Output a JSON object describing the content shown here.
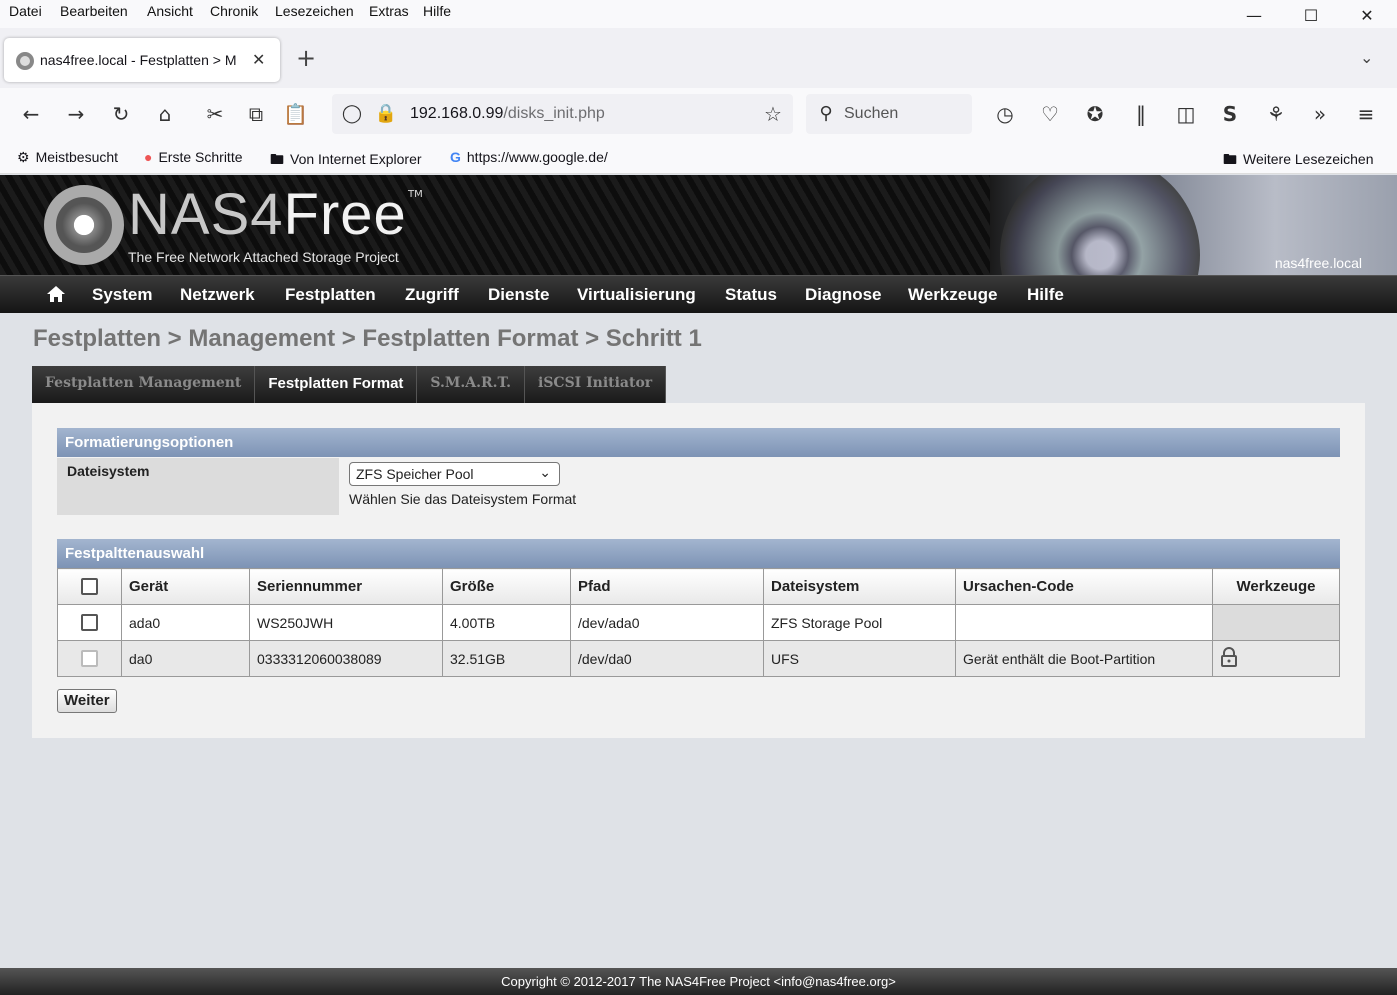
{
  "browser": {
    "menu": [
      "Datei",
      "Bearbeiten",
      "Ansicht",
      "Chronik",
      "Lesezeichen",
      "Extras",
      "Hilfe"
    ],
    "tab_title": "nas4free.local - Festplatten > M",
    "url_host": "192.168.0.99",
    "url_path": "/disks_init.php",
    "search_placeholder": "Suchen",
    "bookmarks": [
      "Meistbesucht",
      "Erste Schritte",
      "Von Internet Explorer",
      "https://www.google.de/"
    ],
    "other_bookmarks": "Weitere Lesezeichen"
  },
  "header": {
    "logo_main": "NAS4",
    "logo_main2": "Free",
    "logo_tm": "TM",
    "logo_subtitle": "The Free Network Attached Storage Project",
    "hostname": "nas4free.local"
  },
  "nav": [
    "System",
    "Netzwerk",
    "Festplatten",
    "Zugriff",
    "Dienste",
    "Virtualisierung",
    "Status",
    "Diagnose",
    "Werkzeuge",
    "Hilfe"
  ],
  "breadcrumb": "Festplatten > Management > Festplatten Format > Schritt 1",
  "tabs": [
    "Festplatten Management",
    "Festplatten Format",
    "S.M.A.R.T.",
    "iSCSI Initiator"
  ],
  "format_options": {
    "section_title": "Formatierungsoptionen",
    "label": "Dateisystem",
    "selected": "ZFS Speicher Pool",
    "hint": "Wählen Sie das Dateisystem Format"
  },
  "disk_selection": {
    "section_title": "Festpalttenauswahl",
    "columns": [
      "Gerät",
      "Seriennummer",
      "Größe",
      "Pfad",
      "Dateisystem",
      "Ursachen-Code",
      "Werkzeuge"
    ],
    "rows": [
      {
        "device": "ada0",
        "serial": "WS250JWH",
        "size": "4.00TB",
        "path": "/dev/ada0",
        "fs": "ZFS Storage Pool",
        "reason": ""
      },
      {
        "device": "da0",
        "serial": "0333312060038089",
        "size": "32.51GB",
        "path": "/dev/da0",
        "fs": "UFS",
        "reason": "Gerät enthält die Boot-Partition"
      }
    ]
  },
  "next_button": "Weiter",
  "footer": "Copyright © 2012-2017 The NAS4Free Project <info@nas4free.org>"
}
